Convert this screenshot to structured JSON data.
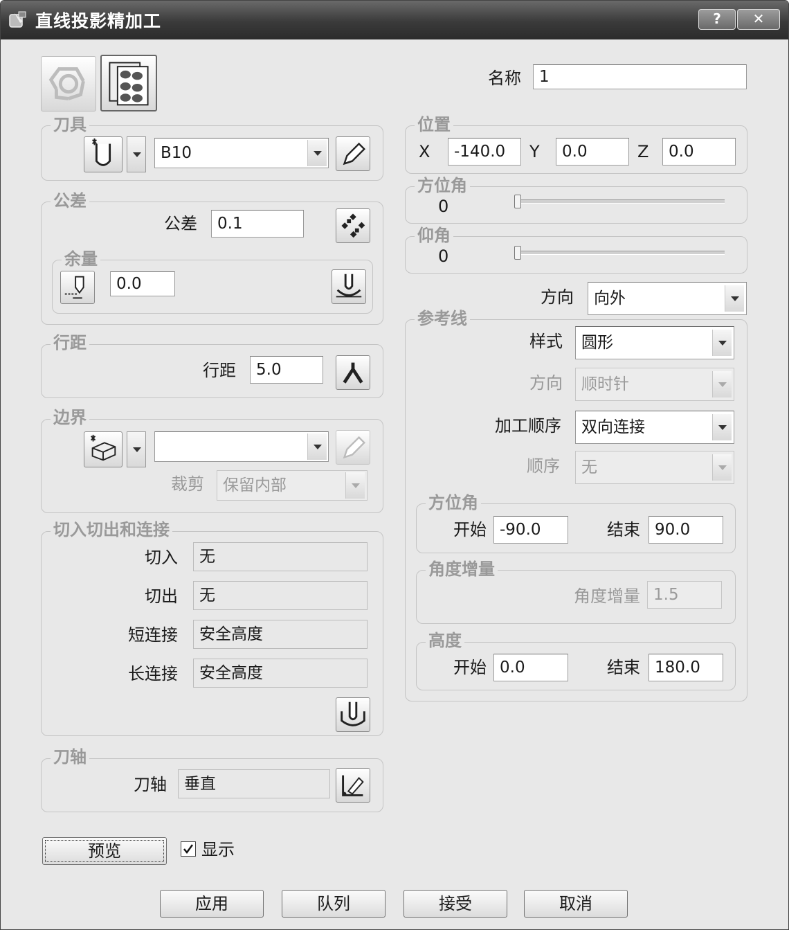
{
  "window": {
    "title": "直线投影精加工",
    "help_label": "?",
    "close_label": "✕"
  },
  "name": {
    "label": "名称",
    "value": "1"
  },
  "tool": {
    "group_label": "刀具",
    "value": "B10"
  },
  "tolerance": {
    "group_label": "公差",
    "label": "公差",
    "value": "0.1",
    "thickness": {
      "group_label": "余量",
      "value": "0.0"
    }
  },
  "stepover": {
    "group_label": "行距",
    "label": "行距",
    "value": "5.0"
  },
  "boundary": {
    "group_label": "边界",
    "value": "",
    "trim_label": "裁剪",
    "trim_value": "保留内部"
  },
  "leads": {
    "group_label": "切入切出和连接",
    "lead_in_label": "切入",
    "lead_in_value": "无",
    "lead_out_label": "切出",
    "lead_out_value": "无",
    "short_link_label": "短连接",
    "short_link_value": "安全高度",
    "long_link_label": "长连接",
    "long_link_value": "安全高度"
  },
  "tool_axis": {
    "group_label": "刀轴",
    "label": "刀轴",
    "value": "垂直"
  },
  "preview": {
    "button_label": "预览",
    "show_label": "显示",
    "show_checked": true
  },
  "position": {
    "group_label": "位置",
    "x_label": "X",
    "x_value": "-140.0",
    "y_label": "Y",
    "y_value": "0.0",
    "z_label": "Z",
    "z_value": "0.0"
  },
  "azimuth": {
    "group_label": "方位角",
    "value": "0",
    "level": 0
  },
  "elevation": {
    "group_label": "仰角",
    "value": "0",
    "level": 0
  },
  "direction": {
    "label": "方向",
    "value": "向外"
  },
  "reference_line": {
    "group_label": "参考线",
    "style_label": "样式",
    "style_value": "圆形",
    "direction_label": "方向",
    "direction_value": "顺时针",
    "order_label": "加工顺序",
    "order_value": "双向连接",
    "sequence_label": "顺序",
    "sequence_value": "无",
    "azimuth": {
      "group_label": "方位角",
      "start_label": "开始",
      "start_value": "-90.0",
      "end_label": "结束",
      "end_value": "90.0"
    },
    "angle_increment": {
      "group_label": "角度增量",
      "label": "角度增量",
      "value": "1.5"
    },
    "height": {
      "group_label": "高度",
      "start_label": "开始",
      "start_value": "0.0",
      "end_label": "结束",
      "end_value": "180.0"
    }
  },
  "buttons": {
    "apply": "应用",
    "queue": "队列",
    "accept": "接受",
    "cancel": "取消"
  }
}
